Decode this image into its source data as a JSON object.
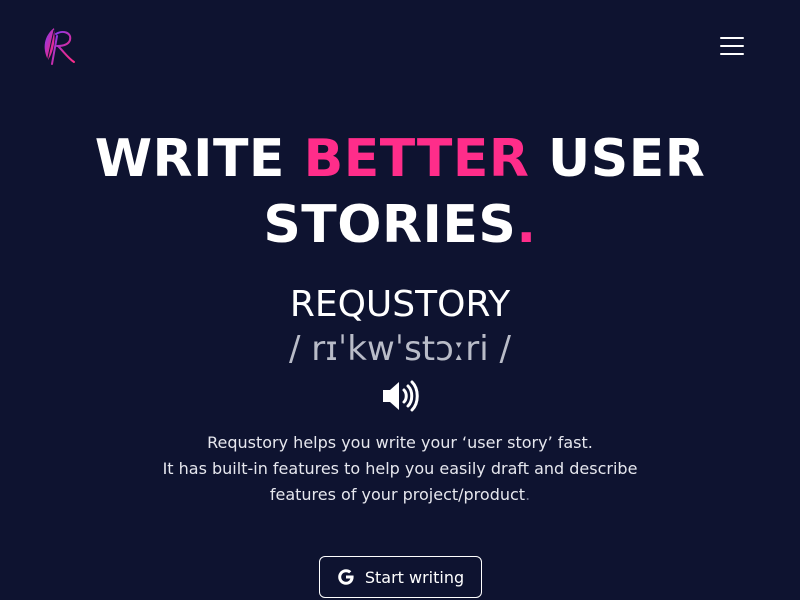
{
  "header": {
    "logo_icon": "feather-quill-r-logo",
    "menu_icon": "hamburger-menu-icon"
  },
  "hero": {
    "headline_word1": "WRITE",
    "headline_accent": "BETTER",
    "headline_word3": "USER",
    "headline_word4": "STORIES",
    "headline_dot": ".",
    "brand_name": "REQUSTORY",
    "phonetic": "/ rɪˈkwˈstɔːri /",
    "speaker_icon": "volume-up-icon",
    "description_line1": "Requstory helps you write your ‘user story’ fast.",
    "description_line2": "It has built-in features to help you easily draft and describe",
    "description_line3": "features of your project/product",
    "description_trailing": ".",
    "cta_label": "Start writing",
    "cta_icon": "google-g-icon"
  },
  "colors": {
    "background": "#0e1330",
    "accent": "#ff2d8a",
    "text": "#ffffff",
    "muted": "#b9bcc8"
  }
}
